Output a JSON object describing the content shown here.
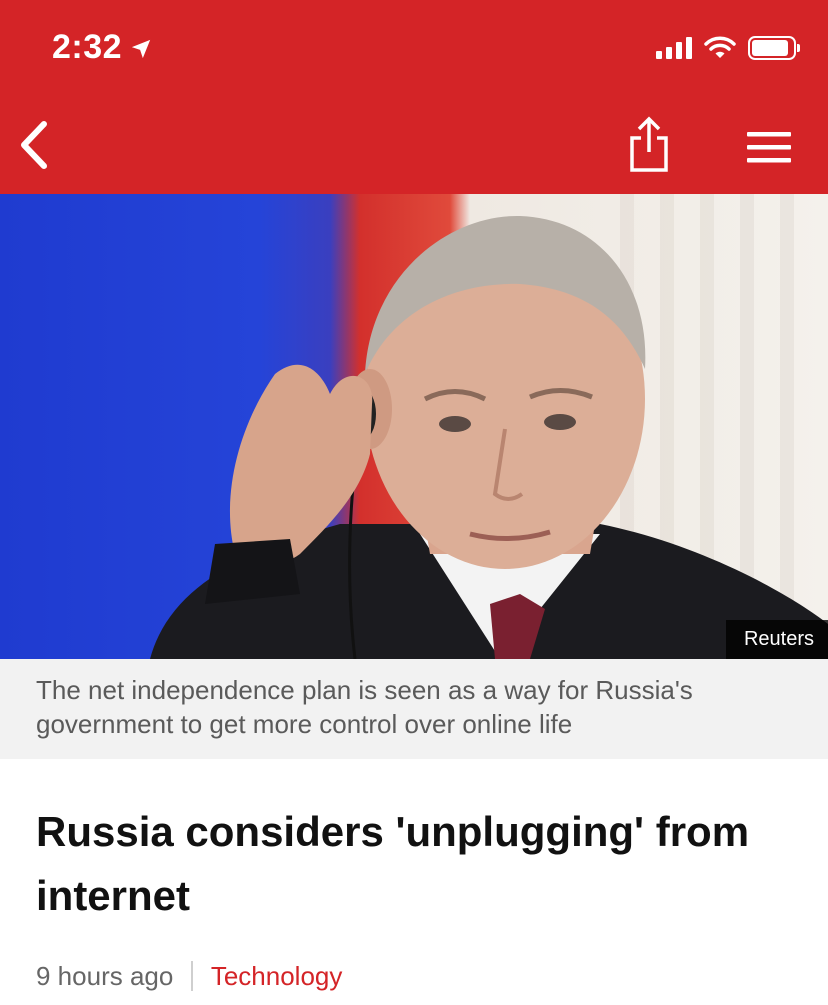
{
  "status_bar": {
    "time": "2:32"
  },
  "nav": {
    "back_icon": "chevron-left-icon",
    "share_icon": "share-icon",
    "menu_icon": "hamburger-menu-icon"
  },
  "hero": {
    "credit": "Reuters"
  },
  "caption": "The net independence plan is seen as a way for Russia's government to get more control over online life",
  "article": {
    "headline": "Russia considers 'unplugging' from internet",
    "time_ago": "9 hours ago",
    "section": "Technology"
  },
  "colors": {
    "brand_red": "#d42427",
    "caption_bg": "#f2f2f2",
    "meta_text": "#666666"
  }
}
